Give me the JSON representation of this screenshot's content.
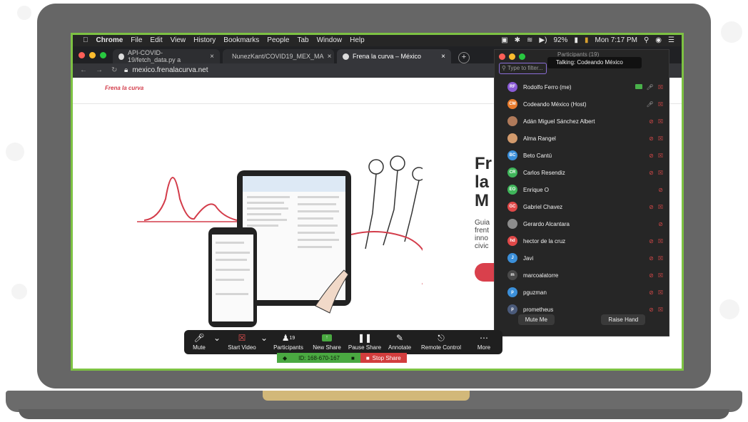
{
  "menubar": {
    "items": [
      "Chrome",
      "File",
      "Edit",
      "View",
      "History",
      "Bookmarks",
      "People",
      "Tab",
      "Window",
      "Help"
    ],
    "battery": "92%",
    "clock": "Mon 7:17 PM"
  },
  "browser": {
    "tabs": [
      {
        "label": "API-COVID-19/fetch_data.py a"
      },
      {
        "label": "NunezKant/COVID19_MEX_MA"
      },
      {
        "label": "Frena la curva – México"
      }
    ],
    "address": "mexico.frenalacurva.net"
  },
  "site": {
    "logo": "Frena la curva",
    "headline": [
      "Fr",
      "la",
      "M"
    ],
    "subtext": [
      "Guia",
      "frent",
      "inno",
      "civic"
    ]
  },
  "participants": {
    "title": "Participants (19)",
    "talking": "Talking: Codeando México",
    "filter_placeholder": "Type to filter...",
    "list": [
      {
        "initials": "RF",
        "name": "Rodolfo Ferro (me)",
        "color": "#8a5ad6"
      },
      {
        "initials": "CM",
        "name": "Codeando México (Host)",
        "color": "#e87b2c"
      },
      {
        "initials": "",
        "name": "Adán Miguel Sánchez Albert",
        "color": "#b07a5a"
      },
      {
        "initials": "",
        "name": "Alma Rangel",
        "color": "#d29a6c"
      },
      {
        "initials": "BC",
        "name": "Beto Cantú",
        "color": "#3b8fd9"
      },
      {
        "initials": "CR",
        "name": "Carlos Resendiz",
        "color": "#3fb55a"
      },
      {
        "initials": "EO",
        "name": "Enrique O",
        "color": "#3fb55a"
      },
      {
        "initials": "GC",
        "name": "Gabriel Chavez",
        "color": "#e04848"
      },
      {
        "initials": "",
        "name": "Gerardo Alcantara",
        "color": "#8c8c8c"
      },
      {
        "initials": "hd",
        "name": "hector de la cruz",
        "color": "#e04848"
      },
      {
        "initials": "J",
        "name": "Javi",
        "color": "#3b8fd9"
      },
      {
        "initials": "m",
        "name": "marcoalatorre",
        "color": "#4a4a4a"
      },
      {
        "initials": "p",
        "name": "pguzman",
        "color": "#3b8fd9"
      },
      {
        "initials": "p",
        "name": "prometheus",
        "color": "#4a5a7a"
      }
    ],
    "mute_me": "Mute Me",
    "raise_hand": "Raise Hand"
  },
  "zoom_toolbar": {
    "mute": "Mute",
    "start_video": "Start Video",
    "participants": "Participants",
    "participants_count": "19",
    "new_share": "New Share",
    "pause_share": "Pause Share",
    "annotate": "Annotate",
    "remote_control": "Remote Control",
    "more": "More"
  },
  "share_bar": {
    "meeting_id": "ID: 168-670-167",
    "stop_share": "Stop Share"
  },
  "colors": {
    "screen_border": "#7dc243",
    "laptop_body": "#666666",
    "share_green": "#4aa941",
    "stop_red": "#d33d3d"
  }
}
